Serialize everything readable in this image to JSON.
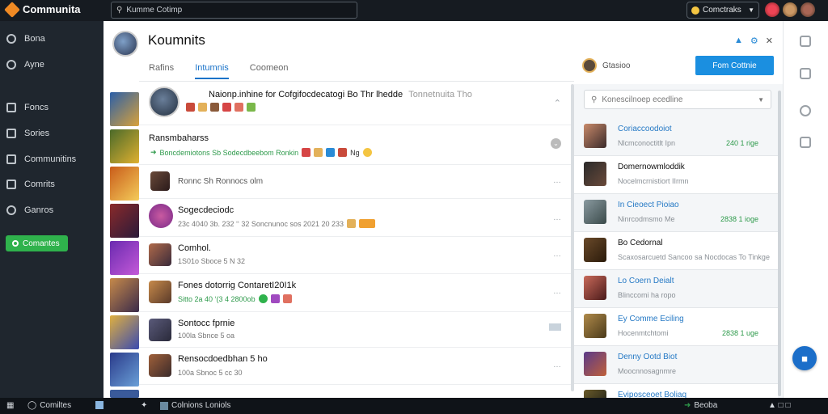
{
  "topbar": {
    "app_name": "Communita",
    "search_placeholder": "Kumme Cotimp",
    "user_label": "Comctraks"
  },
  "nav": {
    "items": [
      {
        "label": "Bona",
        "icon": "home-icon"
      },
      {
        "label": "Ayne",
        "icon": "clock-icon"
      },
      {
        "label": "Foncs",
        "icon": "bookmark-icon"
      },
      {
        "label": "Sories",
        "icon": "check-icon"
      },
      {
        "label": "Communitins",
        "icon": "group-icon"
      },
      {
        "label": "Comrits",
        "icon": "lock-icon"
      },
      {
        "label": "Ganros",
        "icon": "globe-icon"
      }
    ],
    "cta_label": "Comantes"
  },
  "main": {
    "title": "Koumnits",
    "tabs": [
      {
        "label": "Rafins",
        "active": false
      },
      {
        "label": "Intumnis",
        "active": true
      },
      {
        "label": "Coomeon",
        "active": false
      }
    ],
    "rows": [
      {
        "title": "Naionp.inhine for Cofgifocdecatogi Bo Thr lhedde",
        "title_faint": "Tonnetnuita Tho",
        "sub": ""
      },
      {
        "title": "Ransmbaharss",
        "sub": "Boncdemiotons Sb Sodecdbeebom Ronkin",
        "sub_tail": "Ng"
      },
      {
        "title": "Ronnc Sh Ronnocs olm",
        "sub": ""
      },
      {
        "title": "Sogecdeciodc",
        "sub": "23c 4040 3b. 232 ‘‘ 32 Soncnunoc sos 2021 20 233"
      },
      {
        "title": "Comhol.",
        "sub": "1S01o Sboce 5 N 32"
      },
      {
        "title": "Fones dotorrig ContaretI20I1k",
        "sub": "Sitto 2a 40 ‘(3 4 2800ob"
      },
      {
        "title": "Sontocc fprnie",
        "sub": "100la Sbnce 5 oa"
      },
      {
        "title": "Rensocdoedbhan 5 ho",
        "sub": "100a Sbnoc 5 cc 30"
      }
    ],
    "row_more": "…"
  },
  "right": {
    "user_name": "Gtasioo",
    "button_label": "Fom Cottnie",
    "select_value": "Konescilnoep ecedline",
    "items": [
      {
        "title": "Coriaccoodoiot",
        "sub": "Nlcmconoctitlt Ipn",
        "num": "240 1 rige"
      },
      {
        "title": "Domernowmloddik",
        "sub": "Nocelmcrnistiort IIrmn",
        "num": ""
      },
      {
        "title": "In Cieoect Pioiao",
        "sub": "Ninrcodmsmo Me",
        "num": "2838 1 ioge"
      },
      {
        "title": "Bo Cedornal",
        "sub": "Scaxosarcuetd Sancoo sa  Nocdocas To Tinkge",
        "num": ""
      },
      {
        "title": "Lo Coern Deialt",
        "sub": "Blinccomi ha ropo",
        "num": ""
      },
      {
        "title": "Ey Comme Eciling",
        "sub": "Hocenmtchtomi",
        "num": "2838 1 uge"
      },
      {
        "title": "Denny Ootd Biot",
        "sub": "Moocnnosagnmre",
        "num": ""
      },
      {
        "title": "Eviposceoet Boliaq",
        "sub": "",
        "num": ""
      }
    ]
  },
  "taskbar": {
    "app": "Comiltes",
    "window": "Colnions Loniols",
    "tray": "Beoba"
  },
  "colors": {
    "accent": "#1b8fe0",
    "cta_green": "#2fb24c",
    "nav_bg": "#1f262e",
    "topbar_bg": "#161b21"
  }
}
